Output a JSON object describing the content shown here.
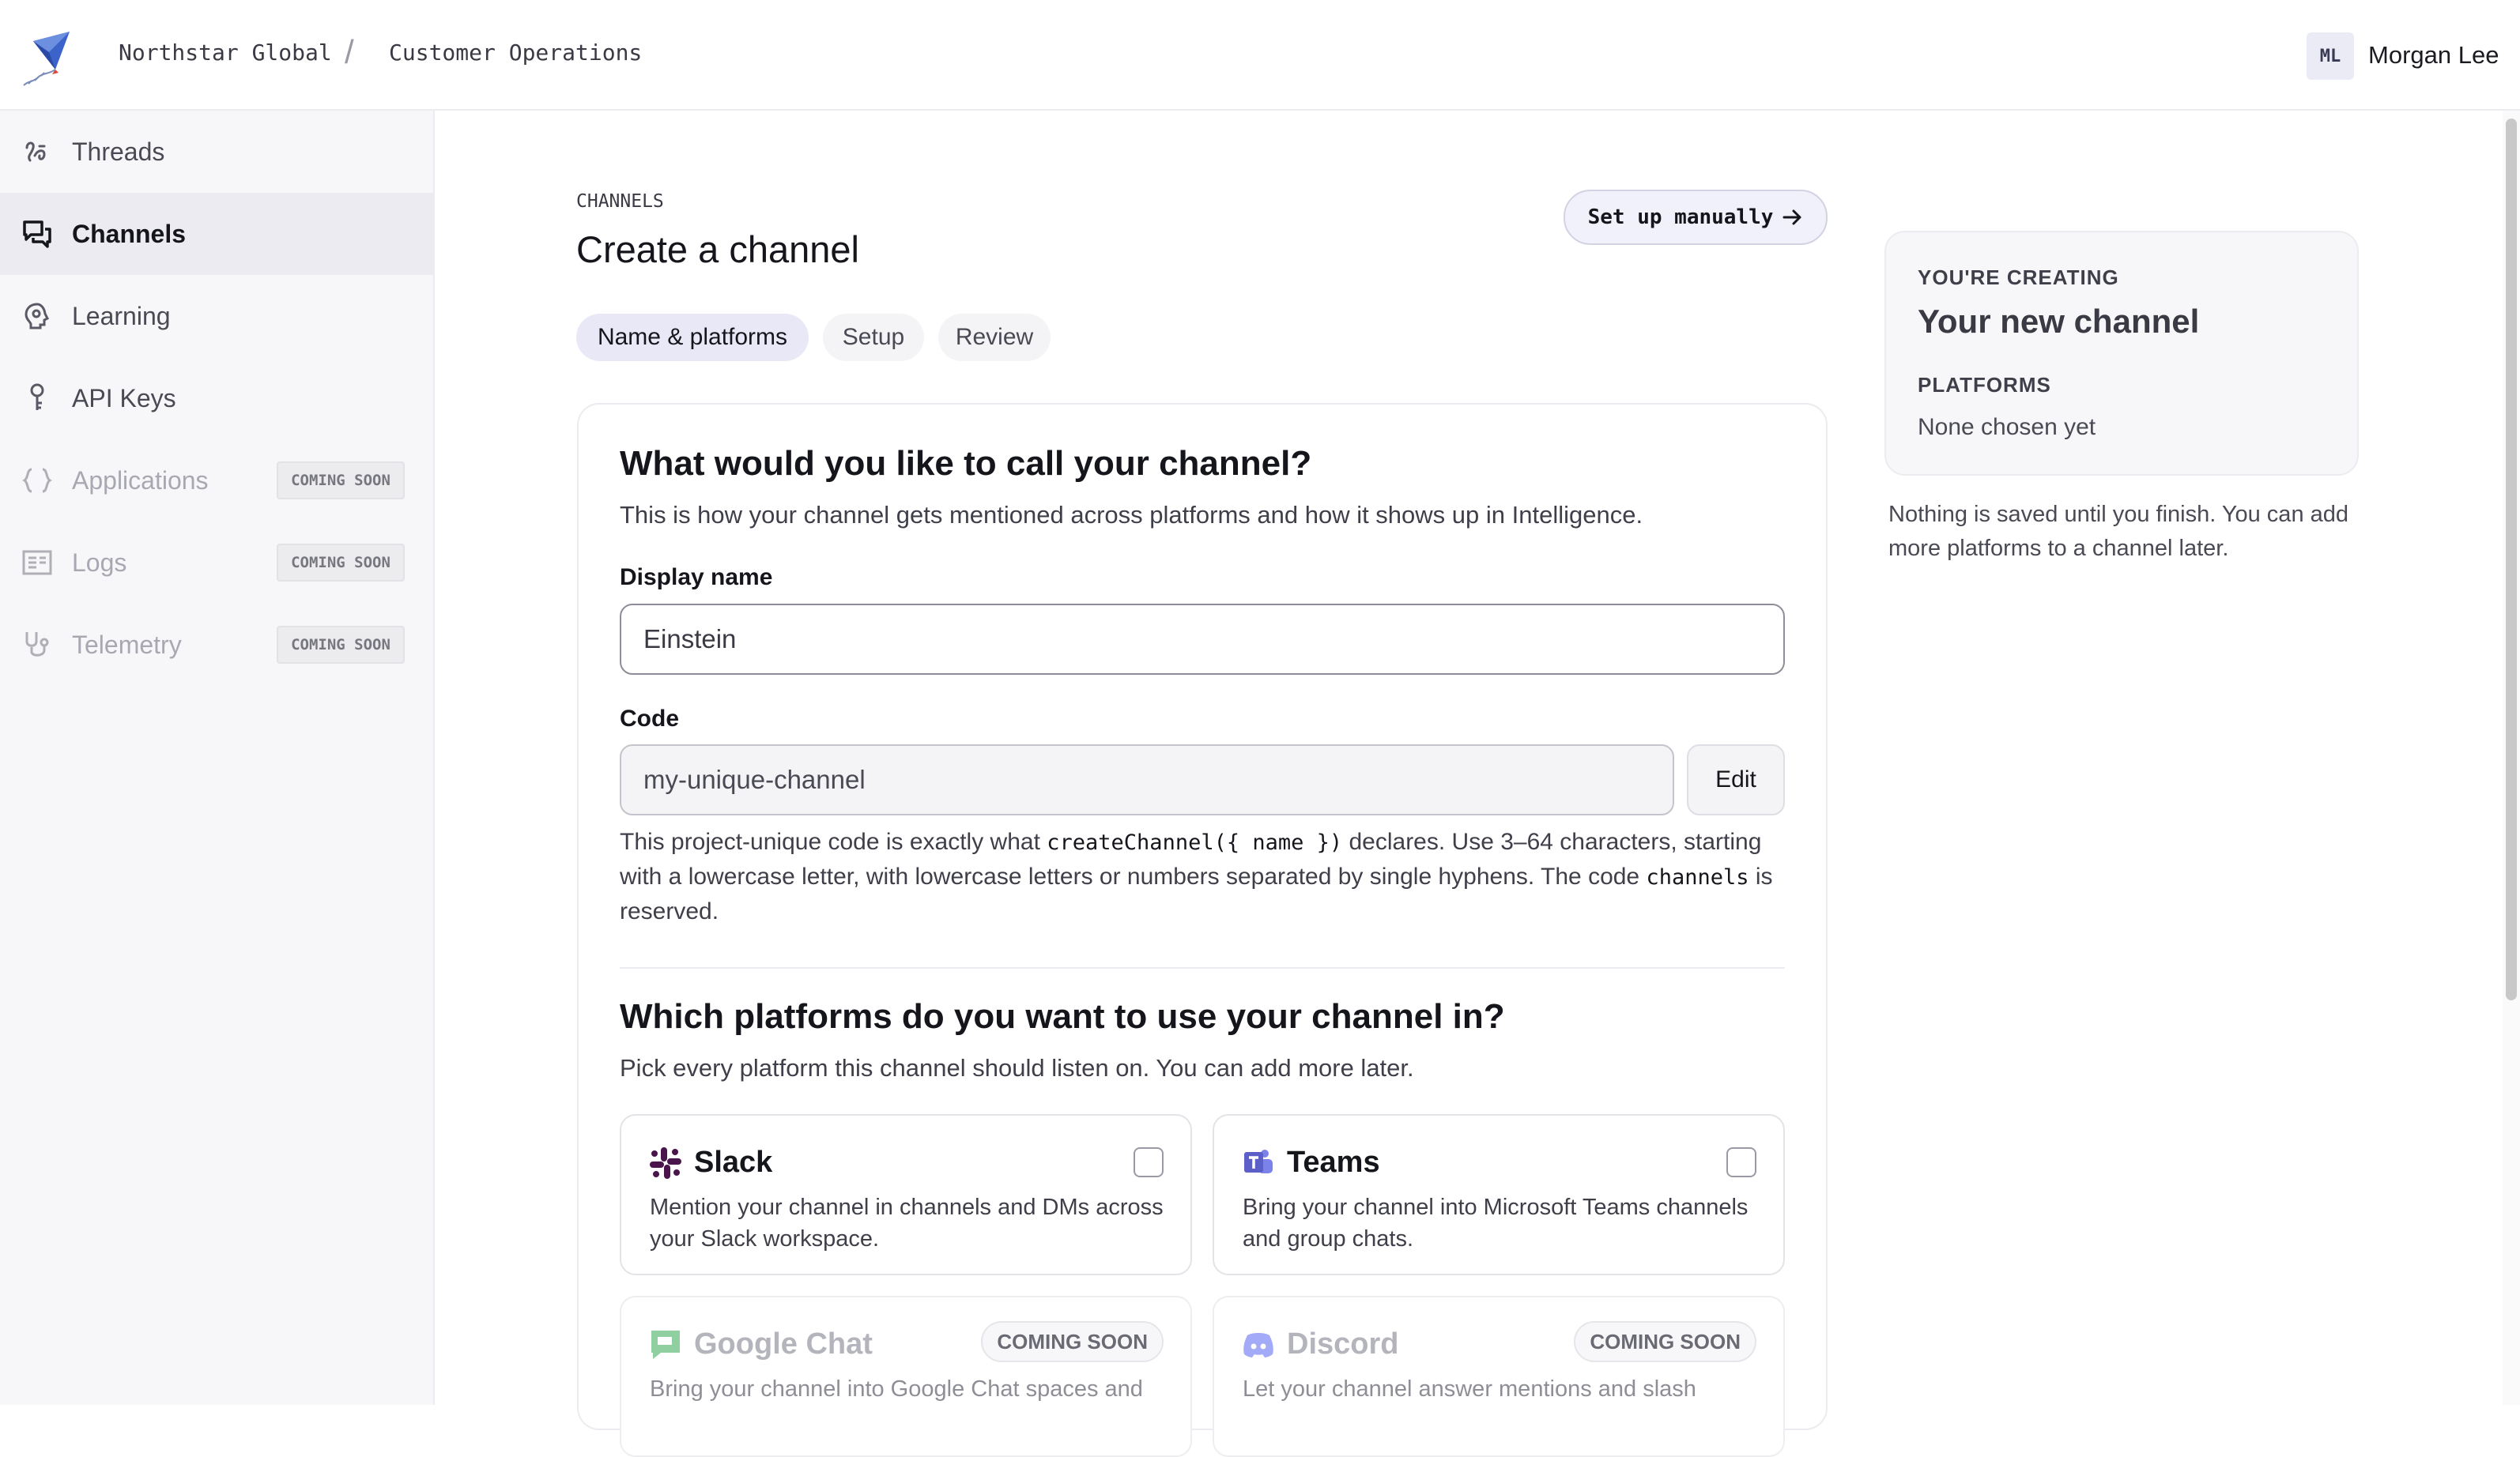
{
  "topbar": {
    "org": "Northstar Global",
    "separator": "/",
    "team": "Customer Operations",
    "user_initials": "ML",
    "user_name": "Morgan Lee"
  },
  "sidebar": {
    "items": [
      {
        "label": "Threads",
        "icon": "threads-icon",
        "active": false,
        "disabled": false
      },
      {
        "label": "Channels",
        "icon": "chat-bubbles-icon",
        "active": true,
        "disabled": false
      },
      {
        "label": "Learning",
        "icon": "brain-icon",
        "active": false,
        "disabled": false
      },
      {
        "label": "API Keys",
        "icon": "key-icon",
        "active": false,
        "disabled": false
      },
      {
        "label": "Applications",
        "icon": "curly-braces-icon",
        "active": false,
        "disabled": true,
        "badge": "COMING SOON"
      },
      {
        "label": "Logs",
        "icon": "log-list-icon",
        "active": false,
        "disabled": true,
        "badge": "COMING SOON"
      },
      {
        "label": "Telemetry",
        "icon": "stethoscope-icon",
        "active": false,
        "disabled": true,
        "badge": "COMING SOON"
      }
    ]
  },
  "header": {
    "eyebrow": "CHANNELS",
    "title": "Create a channel",
    "manual_button": "Set up manually",
    "manual_button_icon": "arrow-right-icon"
  },
  "steps": [
    {
      "label": "Name & platforms",
      "active": true
    },
    {
      "label": "Setup",
      "active": false
    },
    {
      "label": "Review",
      "active": false
    }
  ],
  "form": {
    "name_heading": "What would you like to call your channel?",
    "name_desc": "This is how your channel gets mentioned across platforms and how it shows up in Intelligence.",
    "display_name_label": "Display name",
    "display_name_value": "Einstein",
    "code_label": "Code",
    "code_value": "my-unique-channel",
    "edit_button": "Edit",
    "help_1": "This project-unique code is exactly what ",
    "help_code_1": "createChannel({ name })",
    "help_2": " declares. Use 3–64 characters, starting with a lowercase letter, with lowercase letters or numbers separated by single hyphens. The code ",
    "help_code_2": "channels",
    "help_3": " is reserved.",
    "platforms_heading": "Which platforms do you want to use your channel in?",
    "platforms_desc": "Pick every platform this channel should listen on. You can add more later."
  },
  "platforms": [
    {
      "name": "Slack",
      "icon": "slack-icon",
      "desc": "Mention your channel in channels and DMs across your Slack workspace.",
      "checked": false
    },
    {
      "name": "Teams",
      "icon": "teams-icon",
      "desc": "Bring your channel into Microsoft Teams channels and group chats.",
      "checked": false
    },
    {
      "name": "Google Chat",
      "icon": "google-chat-icon",
      "desc": "Bring your channel into Google Chat spaces and",
      "badge": "COMING SOON"
    },
    {
      "name": "Discord",
      "icon": "discord-icon",
      "desc": "Let your channel answer mentions and slash",
      "badge": "COMING SOON"
    }
  ],
  "summary": {
    "eyebrow": "YOU'RE CREATING",
    "title": "Your new channel",
    "platforms_label": "PLATFORMS",
    "platforms_value": "None chosen yet",
    "note": "Nothing is saved until you finish. You can add more platforms to a channel later."
  },
  "colors": {
    "accent_bg": "#e8e8f6",
    "slack": "#4a154b",
    "teams": "#5b5fc7",
    "google_chat": "#34a853",
    "discord": "#5865f2"
  }
}
